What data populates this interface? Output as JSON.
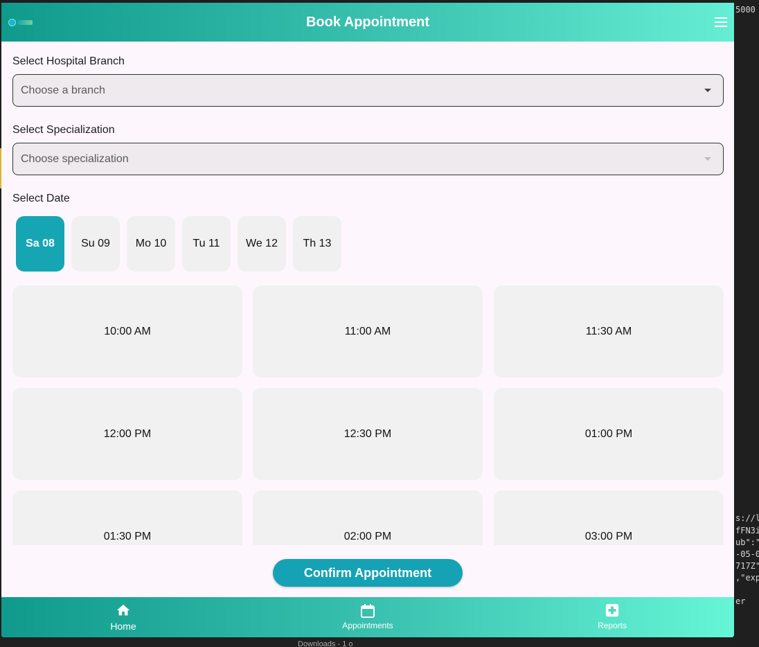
{
  "background": {
    "code_fragments": [
      "5000",
      "s://l",
      "fFN3i",
      "ub\":\"",
      "-05-0",
      "717Z\"",
      ",\"exp",
      "er"
    ],
    "taskbar_text": "Downloads - 1 o"
  },
  "header": {
    "title": "Book Appointment",
    "colors": {
      "start": "#0f9a8c",
      "end": "#66eed4"
    }
  },
  "form": {
    "branch": {
      "label": "Select Hospital Branch",
      "placeholder": "Choose a branch"
    },
    "specialization": {
      "label": "Select Specialization",
      "placeholder": "Choose specialization"
    },
    "date": {
      "label": "Select Date"
    }
  },
  "dates": [
    {
      "label": "Sa 08",
      "selected": true
    },
    {
      "label": "Su 09",
      "selected": false
    },
    {
      "label": "Mo 10",
      "selected": false
    },
    {
      "label": "Tu 11",
      "selected": false
    },
    {
      "label": "We 12",
      "selected": false
    },
    {
      "label": "Th 13",
      "selected": false
    }
  ],
  "time_slots": [
    "10:00 AM",
    "11:00 AM",
    "11:30 AM",
    "12:00 PM",
    "12:30 PM",
    "01:00 PM",
    "01:30 PM",
    "02:00 PM",
    "03:00 PM"
  ],
  "confirm_label": "Confirm Appointment",
  "accent_color": "#15a2b4",
  "bottom_nav": [
    {
      "label": "Home",
      "icon": "home-icon",
      "active": true
    },
    {
      "label": "Appointments",
      "icon": "calendar-icon",
      "active": false
    },
    {
      "label": "Reports",
      "icon": "medical-report-icon",
      "active": false
    }
  ]
}
